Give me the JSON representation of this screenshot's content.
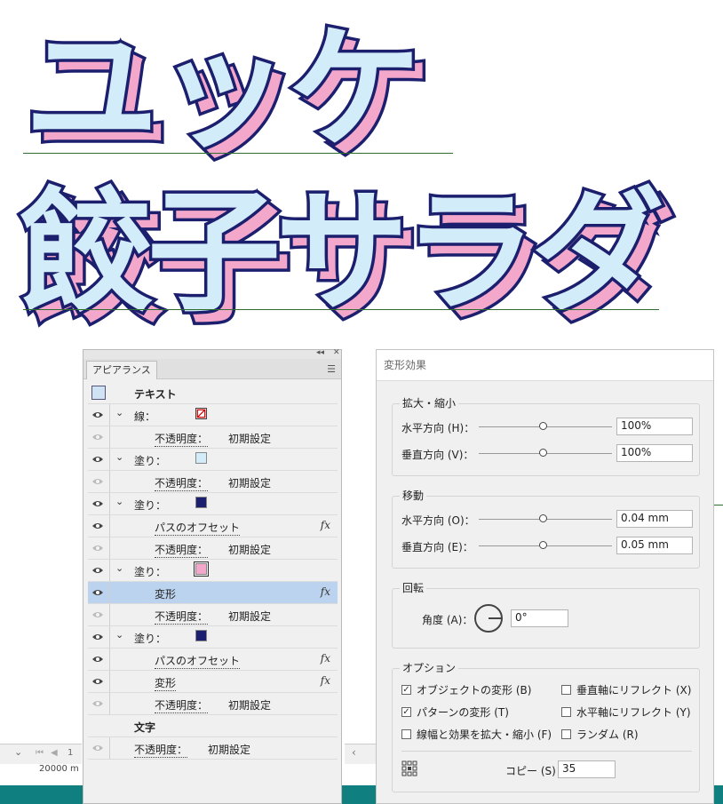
{
  "artwork": {
    "line1": "ユッケ",
    "line2": "餃子サラダ"
  },
  "status": {
    "page_number": "1",
    "partial_text": "20000 m"
  },
  "appearance_panel": {
    "tab_label": "アピアランス",
    "rows": [
      {
        "type": "header",
        "label": "テキスト"
      },
      {
        "type": "attr",
        "label": "線：",
        "swatch": "stroke"
      },
      {
        "type": "opacity",
        "label": "不透明度：",
        "value": "初期設定"
      },
      {
        "type": "attr",
        "label": "塗り：",
        "swatch": "#d3ecf9"
      },
      {
        "type": "opacity",
        "label": "不透明度：",
        "value": "初期設定"
      },
      {
        "type": "attr",
        "label": "塗り：",
        "swatch": "#1b1f6e"
      },
      {
        "type": "effect",
        "label": "パスのオフセット",
        "fx": "fx"
      },
      {
        "type": "opacity",
        "label": "不透明度：",
        "value": "初期設定"
      },
      {
        "type": "attr",
        "label": "塗り：",
        "swatch": "#f3a7cb"
      },
      {
        "type": "effect",
        "label": "変形",
        "fx": "fx",
        "selected": true
      },
      {
        "type": "opacity",
        "label": "不透明度：",
        "value": "初期設定"
      },
      {
        "type": "attr",
        "label": "塗り：",
        "swatch": "#1b1f6e"
      },
      {
        "type": "effect",
        "label": "パスのオフセット",
        "fx": "fx"
      },
      {
        "type": "effect",
        "label": "変形",
        "fx": "fx"
      },
      {
        "type": "opacity",
        "label": "不透明度：",
        "value": "初期設定"
      },
      {
        "type": "plain",
        "label": "文字"
      },
      {
        "type": "opacity2",
        "label": "不透明度：",
        "value": "初期設定"
      }
    ]
  },
  "transform_dialog": {
    "title": "変形効果",
    "scale": {
      "label": "拡大・縮小",
      "horizontal_label": "水平方向 (H)：",
      "horizontal_value": "100%",
      "vertical_label": "垂直方向 (V)：",
      "vertical_value": "100%"
    },
    "move": {
      "label": "移動",
      "horizontal_label": "水平方向 (O)：",
      "horizontal_value": "0.04 mm",
      "vertical_label": "垂直方向 (E)：",
      "vertical_value": "0.05 mm"
    },
    "rotate": {
      "label": "回転",
      "angle_label": "角度 (A)：",
      "angle_value": "0°"
    },
    "options": {
      "label": "オプション",
      "transform_objects": "オブジェクトの変形 (B)",
      "transform_objects_checked": true,
      "transform_patterns": "パターンの変形 (T)",
      "transform_patterns_checked": true,
      "scale_strokes": "線幅と効果を拡大・縮小 (F)",
      "scale_strokes_checked": false,
      "reflect_x": "垂直軸にリフレクト (X)",
      "reflect_y": "水平軸にリフレクト (Y)",
      "random": "ランダム (R)"
    },
    "copies_label": "コピー (S)",
    "copies_value": "35"
  }
}
